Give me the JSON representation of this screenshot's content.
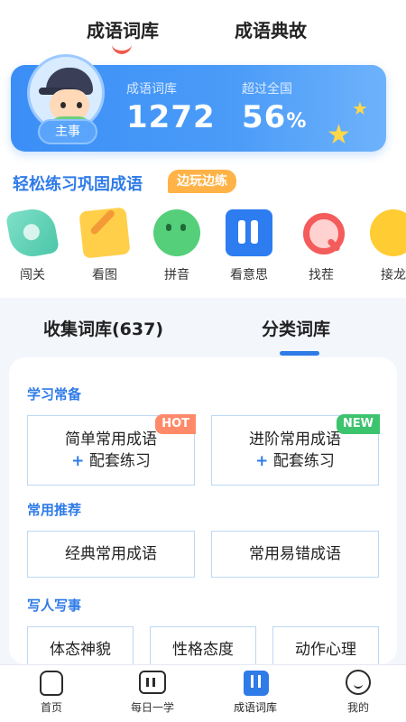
{
  "header": {
    "tabs": [
      {
        "label": "成语词库",
        "active": true
      },
      {
        "label": "成语典故",
        "active": false
      }
    ]
  },
  "stats": {
    "role": "主事",
    "items": [
      {
        "label": "成语词库",
        "value": "1272"
      },
      {
        "label": "超过全国",
        "value": "56",
        "unit": "%"
      }
    ]
  },
  "practice": {
    "title": "轻松练习巩固成语",
    "tag": "边玩边练",
    "items": [
      {
        "label": "闯关",
        "icon": "rocket-icon"
      },
      {
        "label": "看图",
        "icon": "picture-icon"
      },
      {
        "label": "拼音",
        "icon": "pinyin-icon"
      },
      {
        "label": "看意思",
        "icon": "meaning-icon"
      },
      {
        "label": "找茬",
        "icon": "magnifier-icon"
      },
      {
        "label": "接龙",
        "icon": "jielong-icon"
      }
    ]
  },
  "library_tabs": [
    {
      "label": "收集词库(637)",
      "active": false
    },
    {
      "label": "分类词库",
      "active": true
    }
  ],
  "sections": {
    "study": {
      "title": "学习常备",
      "cards": [
        {
          "line1": "简单常用成语",
          "plus": "+",
          "line2": "配套练习",
          "badge": "HOT"
        },
        {
          "line1": "进阶常用成语",
          "plus": "+",
          "line2": "配套练习",
          "badge": "NEW"
        }
      ]
    },
    "recommend": {
      "title": "常用推荐",
      "cards": [
        "经典常用成语",
        "常用易错成语"
      ]
    },
    "people": {
      "title": "写人写事",
      "cards": [
        "体态神貌",
        "性格态度",
        "动作心理"
      ]
    }
  },
  "bottom_nav": [
    {
      "label": "首页",
      "icon": "home-icon"
    },
    {
      "label": "每日一学",
      "icon": "daily-icon"
    },
    {
      "label": "成语词库",
      "icon": "library-icon",
      "active": true
    },
    {
      "label": "我的",
      "icon": "smile-icon"
    }
  ],
  "colors": {
    "accent": "#2f7be8",
    "hot": "#ff8a6a",
    "new": "#3cc36e",
    "card_blue": "#3b8ef6"
  }
}
